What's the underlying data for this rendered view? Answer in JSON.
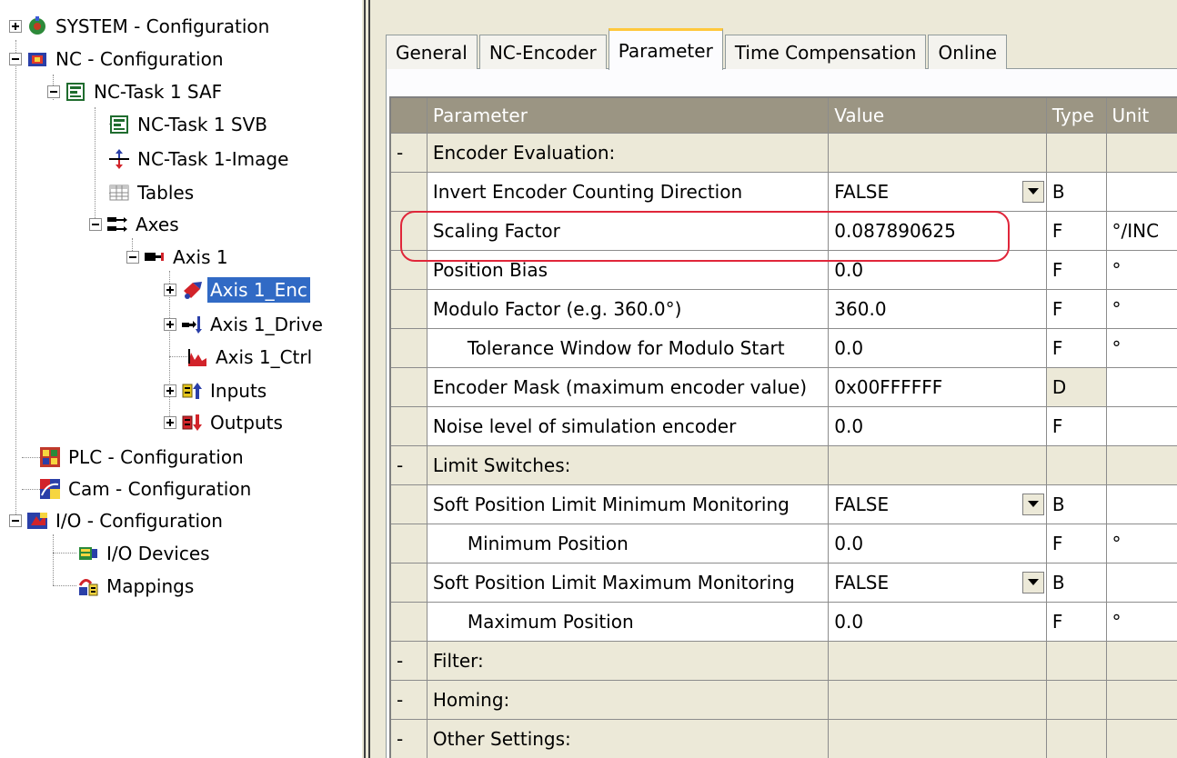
{
  "tree": {
    "items": [
      {
        "label": "SYSTEM - Configuration",
        "icon": "system-config-icon"
      },
      {
        "label": "NC - Configuration",
        "icon": "nc-config-icon"
      },
      {
        "label": "NC-Task 1 SAF",
        "icon": "task-icon"
      },
      {
        "label": "NC-Task 1 SVB",
        "icon": "task-icon"
      },
      {
        "label": "NC-Task 1-Image",
        "icon": "image-icon"
      },
      {
        "label": "Tables",
        "icon": "table-icon"
      },
      {
        "label": "Axes",
        "icon": "axes-icon"
      },
      {
        "label": "Axis 1",
        "icon": "axis-icon"
      },
      {
        "label": "Axis 1_Enc",
        "icon": "encoder-icon"
      },
      {
        "label": "Axis 1_Drive",
        "icon": "drive-icon"
      },
      {
        "label": "Axis 1_Ctrl",
        "icon": "controller-icon"
      },
      {
        "label": "Inputs",
        "icon": "inputs-icon"
      },
      {
        "label": "Outputs",
        "icon": "outputs-icon"
      },
      {
        "label": "PLC - Configuration",
        "icon": "plc-config-icon"
      },
      {
        "label": "Cam - Configuration",
        "icon": "cam-config-icon"
      },
      {
        "label": "I/O - Configuration",
        "icon": "io-config-icon"
      },
      {
        "label": "I/O Devices",
        "icon": "io-devices-icon"
      },
      {
        "label": "Mappings",
        "icon": "mappings-icon"
      }
    ]
  },
  "tabs": [
    "General",
    "NC-Encoder",
    "Parameter",
    "Time Compensation",
    "Online"
  ],
  "grid": {
    "headers": [
      "Parameter",
      "Value",
      "Type",
      "Unit"
    ],
    "rows": [
      {
        "kind": "group",
        "marker": "-",
        "param": "Encoder Evaluation:",
        "value": "",
        "type": "",
        "unit": ""
      },
      {
        "kind": "item",
        "marker": "",
        "param": "Invert Encoder Counting Direction",
        "value": "FALSE",
        "type": "B",
        "unit": ""
      },
      {
        "kind": "item",
        "marker": "",
        "param": "Scaling Factor",
        "value": "0.087890625",
        "type": "F",
        "unit": "°/INC"
      },
      {
        "kind": "item",
        "marker": "",
        "param": "Position Bias",
        "value": "0.0",
        "type": "F",
        "unit": "°"
      },
      {
        "kind": "item",
        "marker": "",
        "param": "Modulo Factor (e.g. 360.0°)",
        "value": "360.0",
        "type": "F",
        "unit": "°"
      },
      {
        "kind": "item",
        "marker": "",
        "param": "Tolerance Window for Modulo Start",
        "value": "0.0",
        "type": "F",
        "unit": "°"
      },
      {
        "kind": "item",
        "marker": "",
        "param": "Encoder Mask (maximum encoder value)",
        "value": "0x00FFFFFF",
        "type": "D",
        "unit": ""
      },
      {
        "kind": "item",
        "marker": "",
        "param": "Noise level of simulation encoder",
        "value": "0.0",
        "type": "F",
        "unit": ""
      },
      {
        "kind": "group",
        "marker": "-",
        "param": "Limit Switches:",
        "value": "",
        "type": "",
        "unit": ""
      },
      {
        "kind": "item",
        "marker": "",
        "param": "Soft Position Limit Minimum Monitoring",
        "value": "FALSE",
        "type": "B",
        "unit": ""
      },
      {
        "kind": "item",
        "marker": "",
        "param": "Minimum Position",
        "value": "0.0",
        "type": "F",
        "unit": "°"
      },
      {
        "kind": "item",
        "marker": "",
        "param": "Soft Position Limit Maximum Monitoring",
        "value": "FALSE",
        "type": "B",
        "unit": ""
      },
      {
        "kind": "item",
        "marker": "",
        "param": "Maximum Position",
        "value": "0.0",
        "type": "F",
        "unit": "°"
      },
      {
        "kind": "group",
        "marker": "-",
        "param": "Filter:",
        "value": "",
        "type": "",
        "unit": ""
      },
      {
        "kind": "group",
        "marker": "-",
        "param": "Homing:",
        "value": "",
        "type": "",
        "unit": ""
      },
      {
        "kind": "group",
        "marker": "-",
        "param": "Other Settings:",
        "value": "",
        "type": "",
        "unit": ""
      }
    ]
  },
  "colors": {
    "selection": "#316ac5",
    "highlight_ring": "#e0263a",
    "header_bg": "#9b9583",
    "panel_bg": "#ece9d8",
    "active_tab_accent": "#ffc83c"
  }
}
